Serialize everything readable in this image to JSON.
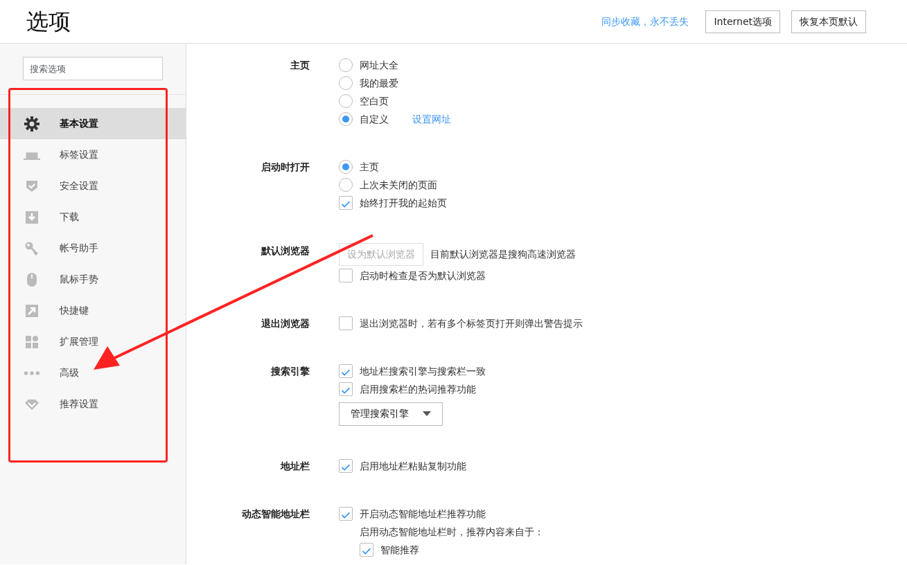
{
  "window": {
    "title": "选项"
  },
  "header": {
    "sync_link": "同步收藏，永不丢失",
    "buttons": [
      "Internet选项",
      "恢复本页默认"
    ]
  },
  "sidebar": {
    "search": {
      "placeholder": "搜索选项"
    },
    "items": [
      {
        "label": "基本设置",
        "selected": true
      },
      {
        "label": "标签设置",
        "selected": false
      },
      {
        "label": "安全设置",
        "selected": false
      },
      {
        "label": "下载",
        "selected": false
      },
      {
        "label": "帐号助手",
        "selected": false
      },
      {
        "label": "鼠标手势",
        "selected": false
      },
      {
        "label": "快捷键",
        "selected": false
      },
      {
        "label": "扩展管理",
        "selected": false
      },
      {
        "label": "高级",
        "selected": false
      },
      {
        "label": "推荐设置",
        "selected": false
      }
    ]
  },
  "sections": [
    {
      "label": "主页",
      "rows": [
        {
          "kind": "radio",
          "label": "网址大全",
          "selected": false
        },
        {
          "kind": "radio",
          "label": "我的最爱",
          "selected": false
        },
        {
          "kind": "radio",
          "label": "空白页",
          "selected": false
        },
        {
          "kind": "radio",
          "label": "自定义",
          "selected": true,
          "link": "设置网址"
        }
      ]
    },
    {
      "label": "启动时打开",
      "rows": [
        {
          "kind": "radio",
          "label": "主页",
          "selected": true
        },
        {
          "kind": "radio",
          "label": "上次未关闭的页面",
          "selected": false
        },
        {
          "kind": "checkbox",
          "label": "始终打开我的起始页",
          "checked": true
        }
      ]
    },
    {
      "label": "默认浏览器",
      "rows": [
        {
          "kind": "button",
          "label": "设为默认浏览器",
          "disabled": true,
          "text": "目前默认浏览器是搜狗高速浏览器"
        },
        {
          "kind": "checkbox",
          "label": "启动时检查是否为默认浏览器",
          "checked": false
        }
      ]
    },
    {
      "label": "退出浏览器",
      "rows": [
        {
          "kind": "checkbox",
          "label": "退出浏览器时，若有多个标签页打开则弹出警告提示",
          "checked": false
        }
      ]
    },
    {
      "label": "搜索引擎",
      "rows": [
        {
          "kind": "checkbox",
          "label": "地址栏搜索引擎与搜索栏一致",
          "checked": true
        },
        {
          "kind": "checkbox",
          "label": "启用搜索栏的热词推荐功能",
          "checked": true
        },
        {
          "kind": "dropdown",
          "label": "管理搜索引擎"
        }
      ]
    },
    {
      "label": "地址栏",
      "rows": [
        {
          "kind": "checkbox",
          "label": "启用地址栏粘贴复制功能",
          "checked": true
        }
      ]
    },
    {
      "label": "动态智能地址栏",
      "rows": [
        {
          "kind": "checkbox",
          "label": "开启动态智能地址栏推荐功能",
          "checked": true,
          "children": [
            {
              "kind": "note",
              "label": "启用动态智能地址栏时，推荐内容来自于："
            },
            {
              "kind": "checkbox",
              "label": "智能推荐",
              "checked": true
            }
          ]
        }
      ]
    }
  ],
  "annotations": {
    "frame": true,
    "arrow": true
  }
}
